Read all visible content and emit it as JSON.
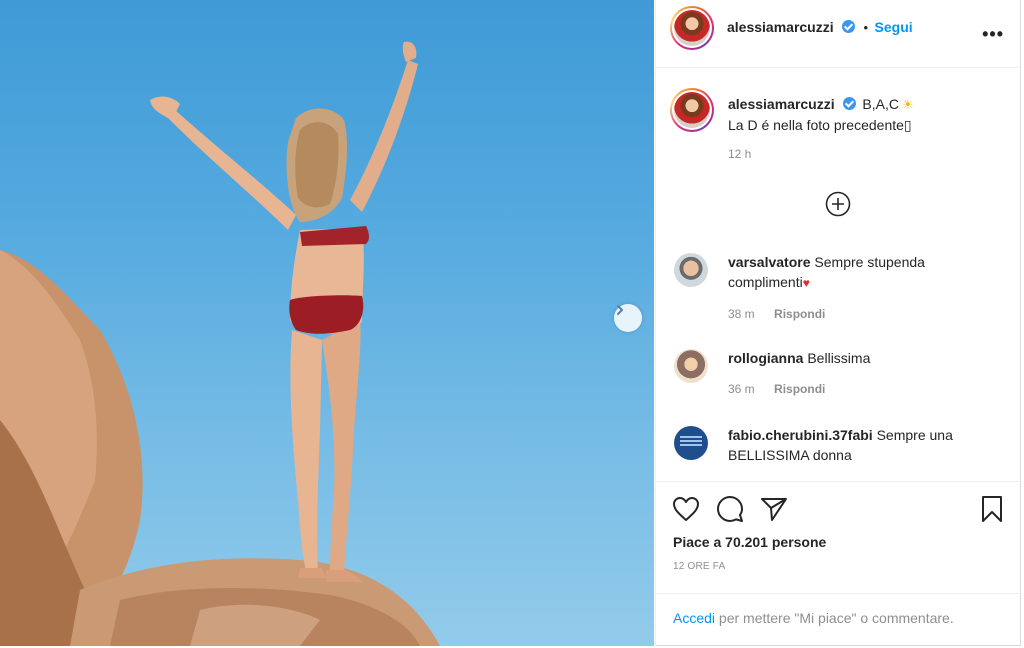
{
  "post": {
    "author": "alessiamarcuzzi",
    "follow_separator": "•",
    "follow_label": "Segui",
    "more_label": "•••",
    "caption_prefix": "B,A,C",
    "caption_emoji": "☀",
    "caption_line2": "La D é nella foto precedente▯",
    "caption_time": "12 h",
    "likes_text": "Piace a 70.201 persone",
    "posted_ago": "12 ORE FA"
  },
  "comments": [
    {
      "user": "varsalvatore",
      "text": "Sempre stupenda",
      "text2": "complimenti",
      "emoji": "♥",
      "time": "38 m",
      "reply": "Rispondi"
    },
    {
      "user": "rollogianna",
      "text": "Bellissima",
      "time": "36 m",
      "reply": "Rispondi"
    },
    {
      "user": "fabio.cherubini.37fabi",
      "text": "Sempre una",
      "text2": "BELLISSIMA donna"
    }
  ],
  "login": {
    "link": "Accedi",
    "rest": "per mettere \"Mi piace\" o commentare."
  },
  "icons": {
    "next": "chevron-right-icon",
    "load_more": "plus-circle-icon",
    "like": "heart-icon",
    "comment": "comment-icon",
    "share": "paper-plane-icon",
    "save": "bookmark-icon",
    "verified": "verified-badge-icon",
    "more": "more-options-icon"
  },
  "colors": {
    "link_blue": "#0095f6",
    "text": "#262626",
    "muted": "#8e8e8e",
    "sky": "#55aadf"
  }
}
